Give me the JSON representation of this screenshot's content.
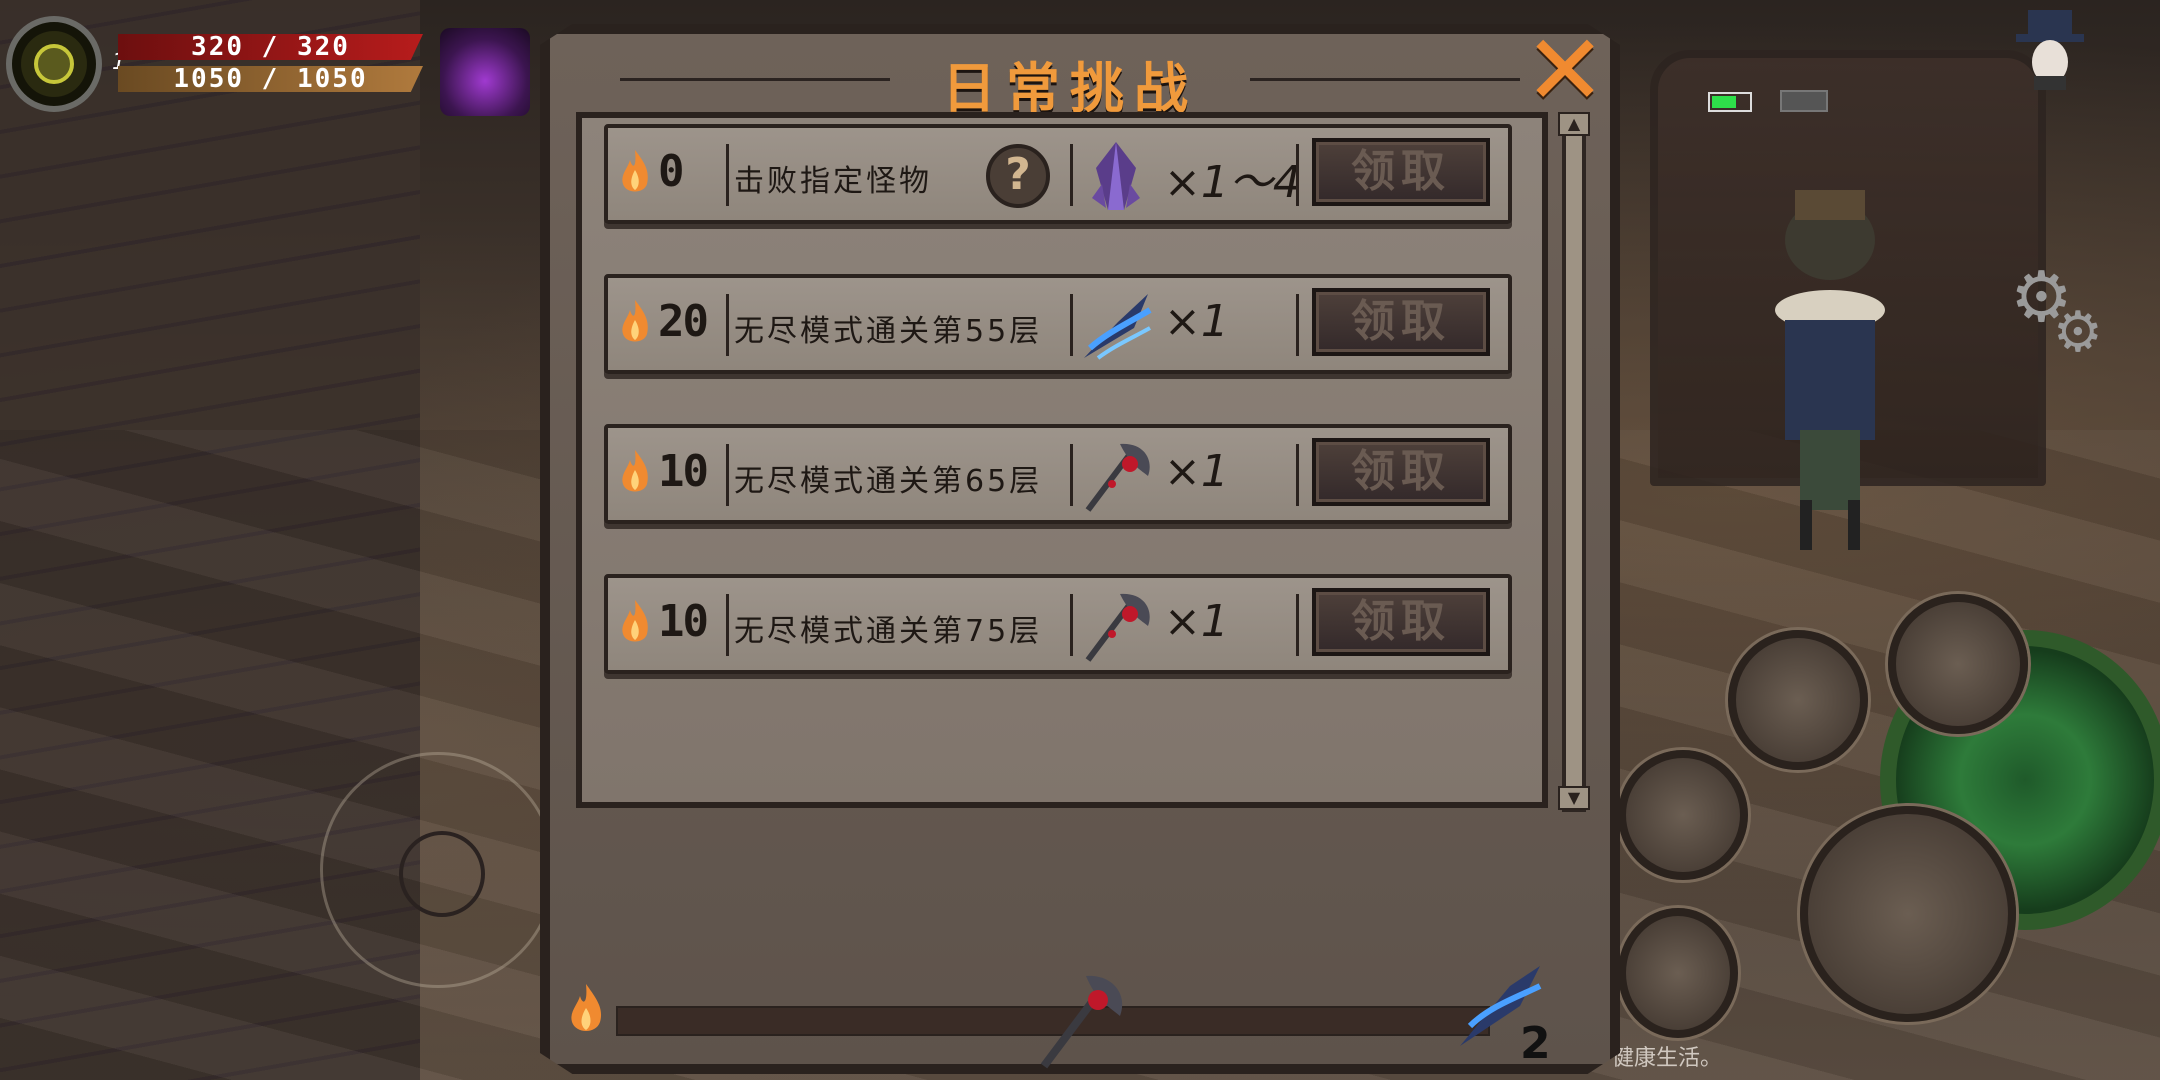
{
  "hud": {
    "level": "1",
    "hp": "320 / 320",
    "hp_fraction": 1.0,
    "mp": "1050 / 1050",
    "mp_fraction": 1.0,
    "battery_fraction": 0.6
  },
  "dialog": {
    "title": "日常挑战",
    "close_icon": "close-x-icon",
    "tasks": [
      {
        "score": "0",
        "description": "击败指定怪物",
        "hint_icon": "question-mark-icon",
        "reward_icon": "purple-crystal-icon",
        "reward_qty": "×1～4",
        "claim_label": "领取"
      },
      {
        "score": "20",
        "description": "无尽模式通关第55层",
        "reward_icon": "blue-claw-weapon-icon",
        "reward_qty": "×1",
        "claim_label": "领取"
      },
      {
        "score": "10",
        "description": "无尽模式通关第65层",
        "reward_icon": "red-axe-weapon-icon",
        "reward_qty": "×1",
        "claim_label": "领取"
      },
      {
        "score": "10",
        "description": "无尽模式通关第75层",
        "reward_icon": "red-axe-weapon-icon",
        "reward_qty": "×1",
        "claim_label": "领取"
      }
    ],
    "progress": {
      "fraction": 0.0,
      "milestone_reward_count": "2"
    }
  },
  "footer_text": "健康生活。",
  "colors": {
    "title_orange": "#f09a3c",
    "close_orange": "#f08a30",
    "panel": "#8d837a",
    "hp_red": "#b71c1c"
  }
}
